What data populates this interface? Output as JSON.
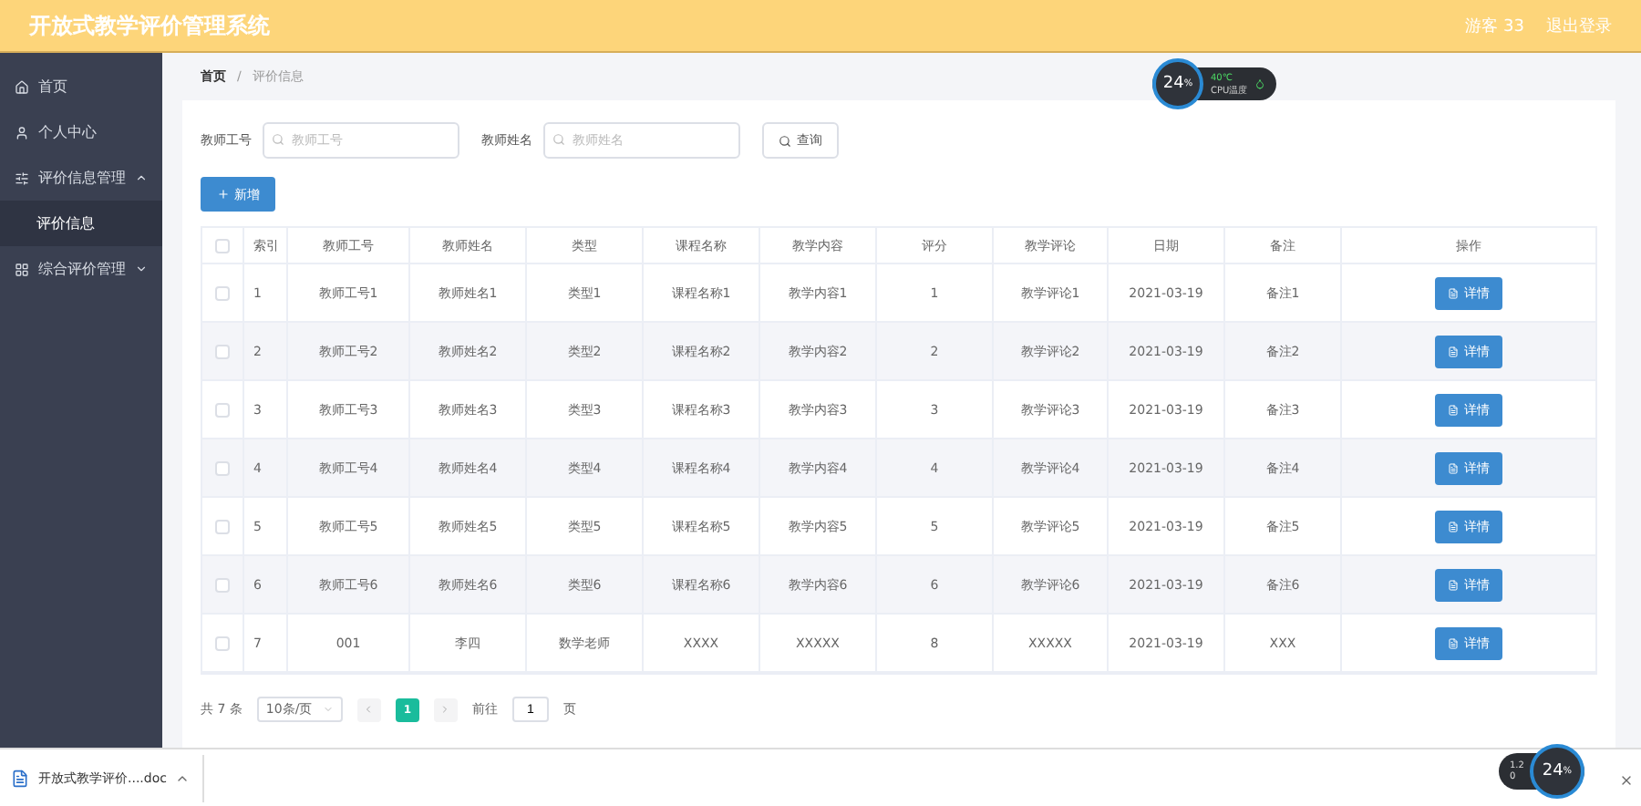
{
  "header": {
    "title": "开放式教学评价管理系统",
    "user": "游客 33",
    "logout": "退出登录"
  },
  "sidebar": {
    "items": [
      {
        "label": "首页",
        "selected": false
      },
      {
        "label": "个人中心",
        "selected": false
      },
      {
        "label": "评价信息管理",
        "selected": false,
        "expanded": true,
        "children": [
          {
            "label": "评价信息",
            "selected": true
          }
        ]
      },
      {
        "label": "综合评价管理",
        "selected": false,
        "expanded": false
      }
    ]
  },
  "breadcrumb": {
    "items": [
      "首页",
      "评价信息"
    ],
    "separator": "/"
  },
  "search": {
    "fields": [
      {
        "label": "教师工号",
        "placeholder": "教师工号"
      },
      {
        "label": "教师姓名",
        "placeholder": "教师姓名"
      }
    ],
    "button": "查询"
  },
  "add_button": "新增",
  "table": {
    "all_checked": false,
    "columns": [
      "索引",
      "教师工号",
      "教师姓名",
      "类型",
      "课程名称",
      "教学内容",
      "评分",
      "教学评论",
      "日期",
      "备注",
      "操作"
    ],
    "rows": [
      {
        "checked": false,
        "cells": [
          "1",
          "教师工号1",
          "教师姓名1",
          "类型1",
          "课程名称1",
          "教学内容1",
          "1",
          "教学评论1",
          "2021-03-19",
          "备注1"
        ],
        "action": "详情"
      },
      {
        "checked": false,
        "cells": [
          "2",
          "教师工号2",
          "教师姓名2",
          "类型2",
          "课程名称2",
          "教学内容2",
          "2",
          "教学评论2",
          "2021-03-19",
          "备注2"
        ],
        "action": "详情"
      },
      {
        "checked": false,
        "cells": [
          "3",
          "教师工号3",
          "教师姓名3",
          "类型3",
          "课程名称3",
          "教学内容3",
          "3",
          "教学评论3",
          "2021-03-19",
          "备注3"
        ],
        "action": "详情"
      },
      {
        "checked": false,
        "cells": [
          "4",
          "教师工号4",
          "教师姓名4",
          "类型4",
          "课程名称4",
          "教学内容4",
          "4",
          "教学评论4",
          "2021-03-19",
          "备注4"
        ],
        "action": "详情"
      },
      {
        "checked": false,
        "cells": [
          "5",
          "教师工号5",
          "教师姓名5",
          "类型5",
          "课程名称5",
          "教学内容5",
          "5",
          "教学评论5",
          "2021-03-19",
          "备注5"
        ],
        "action": "详情"
      },
      {
        "checked": false,
        "cells": [
          "6",
          "教师工号6",
          "教师姓名6",
          "类型6",
          "课程名称6",
          "教学内容6",
          "6",
          "教学评论6",
          "2021-03-19",
          "备注6"
        ],
        "action": "详情"
      },
      {
        "checked": false,
        "cells": [
          "7",
          "001",
          "李四",
          "数学老师",
          "XXXX",
          "XXXXX",
          "8",
          "XXXXX",
          "2021-03-19",
          "XXX"
        ],
        "action": "详情"
      }
    ]
  },
  "pagination": {
    "total": "共 7 条",
    "page_size": "10条/页",
    "pages": [
      {
        "label": "1",
        "selected": true
      }
    ],
    "goto_label": "前往",
    "goto_value": "1",
    "goto_suffix": "页"
  },
  "cpu_widget": {
    "percent": "24",
    "unit": "%",
    "temp": "40℃",
    "label": "CPU温度"
  },
  "download_bar": {
    "file": "开放式教学评价....doc"
  },
  "net_widget": {
    "up": "1.2",
    "down": "0",
    "percent": "24",
    "unit": "%"
  }
}
